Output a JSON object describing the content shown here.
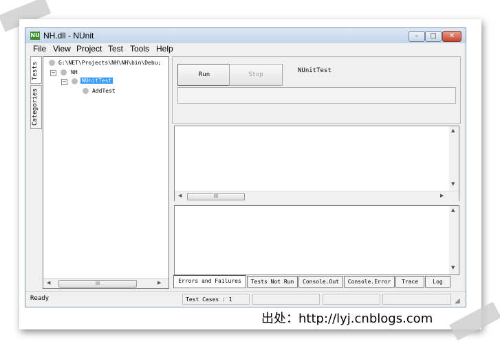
{
  "window": {
    "title": "NH.dll - NUnit",
    "icon_text": "NU"
  },
  "menu": [
    {
      "label": "File"
    },
    {
      "label": "View"
    },
    {
      "label": "Project"
    },
    {
      "label": "Test"
    },
    {
      "label": "Tools"
    },
    {
      "label": "Help"
    }
  ],
  "side_tabs": {
    "tests": "Tests",
    "categories": "Categories"
  },
  "tree": {
    "root": "G:\\NET\\Projects\\NH\\NH\\bin\\Debu;",
    "ns": "NH",
    "fixture": "NUnitTest",
    "test": "AddTest"
  },
  "run_panel": {
    "run_label": "Run",
    "stop_label": "Stop",
    "current_test": "NUnitTest"
  },
  "scroll": {
    "thumb_glyph": "III"
  },
  "result_tabs": [
    "Errors and Failures",
    "Tests Not Run",
    "Console.Out",
    "Console.Error",
    "Trace",
    "Log"
  ],
  "status": {
    "state": "Ready",
    "test_cases": "Test Cases : 1"
  },
  "credit": "出处：http://lyj.cnblogs.com"
}
